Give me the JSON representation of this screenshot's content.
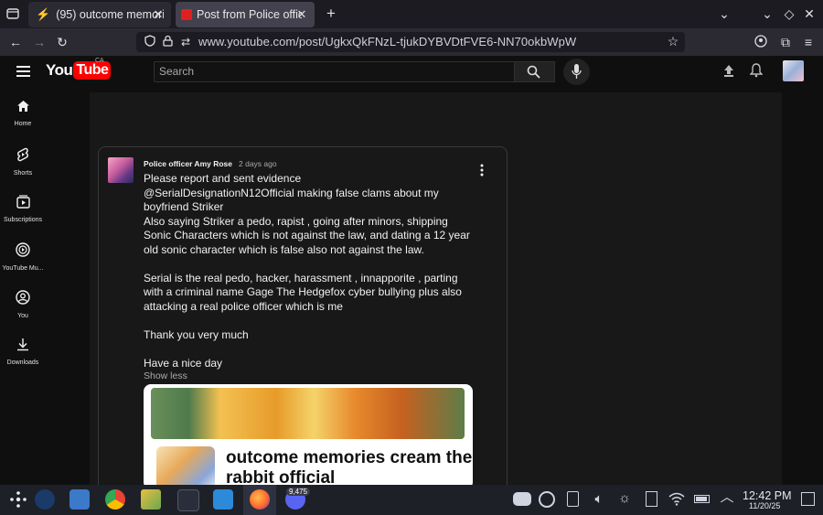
{
  "browser": {
    "tabs": [
      {
        "label": "(95) outcome memories",
        "active": false
      },
      {
        "label": "Post from Police officer A",
        "active": true
      }
    ],
    "url": "www.youtube.com/post/UgkxQkFNzL-tjukDYBVDtFVE6-NN70okbWpW"
  },
  "youtube": {
    "logo_text": "YouTube",
    "region": "CA",
    "search_placeholder": "Search"
  },
  "sidebar": {
    "items": [
      {
        "label": "Home",
        "icon": "home-icon"
      },
      {
        "label": "Shorts",
        "icon": "shorts-icon"
      },
      {
        "label": "Subscriptions",
        "icon": "subscriptions-icon"
      },
      {
        "label": "YouTube Mu...",
        "icon": "youtube-music-icon"
      },
      {
        "label": "You",
        "icon": "you-icon"
      },
      {
        "label": "Downloads",
        "icon": "downloads-icon"
      }
    ]
  },
  "post": {
    "author": "Police officer Amy Rose",
    "time": "2 days ago",
    "paragraphs": [
      "Please report and sent evidence",
      "@SerialDesignationN12Official making false clams about my boyfriend Striker",
      "Also saying Striker  a pedo, rapist , going after minors, shipping Sonic Characters which is not against the law, and dating a 12 year old sonic character which is false also not against the law.",
      "",
      "Serial is the real pedo, hacker, harassment , innapporite , parting with a criminal name Gage The Hedgefox cyber bullying plus also attacking a real police officer which is me",
      "",
      "Thank you very much",
      "",
      "Have a nice day"
    ],
    "show_less": "Show less",
    "image_title": "outcome memories cream the rabbit official"
  },
  "taskbar": {
    "discord_badge": "9,475",
    "time": "12:42 PM",
    "date": "11/20/25"
  },
  "colors": {
    "youtube_red": "#ff0000",
    "browser_bg": "#1c1b22",
    "page_bg": "#0f0f0f"
  }
}
